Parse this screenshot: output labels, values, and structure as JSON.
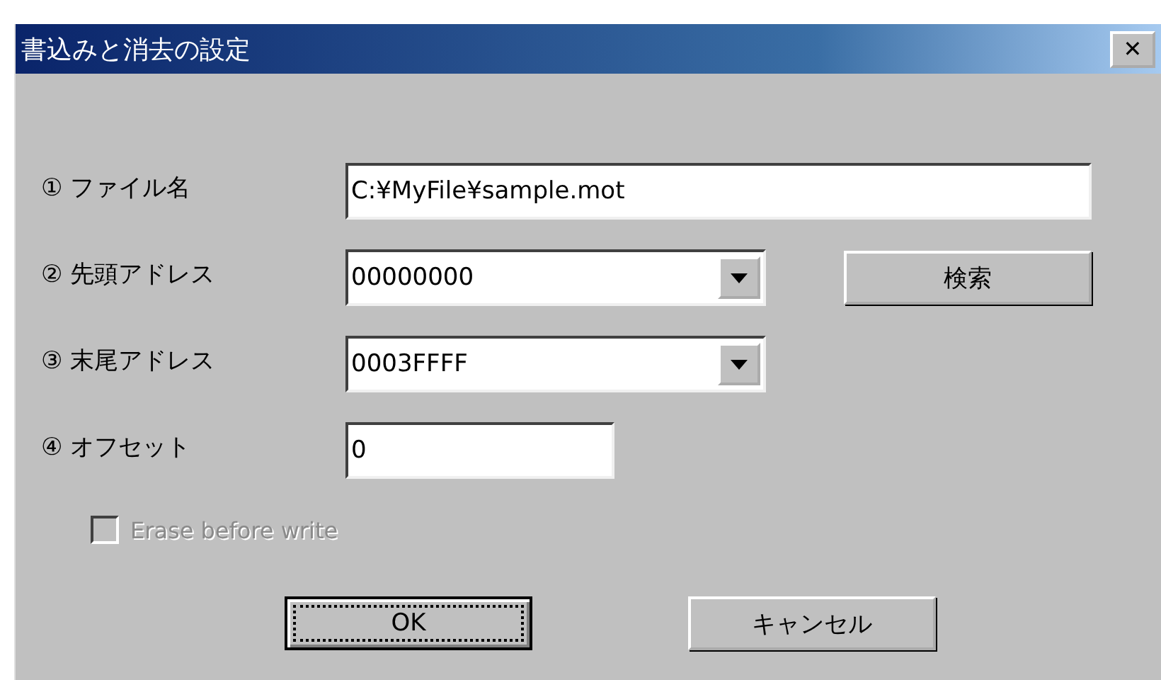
{
  "window": {
    "title": "書込みと消去の設定",
    "close": "✕"
  },
  "fields": [
    {
      "kind": "text",
      "label": "① ファイル名",
      "value": "C:¥MyFile¥sample.mot"
    },
    {
      "kind": "combo",
      "label": "② 先頭アドレス",
      "value": "00000000",
      "button": "検索"
    },
    {
      "kind": "combo",
      "label": "③ 末尾アドレス",
      "value": "0003FFFF"
    },
    {
      "kind": "short",
      "label": "④ オフセット",
      "value": "0"
    }
  ],
  "checkbox": {
    "label": "Erase before write",
    "checked": false,
    "disabled": true
  },
  "buttons": [
    {
      "label": "OK",
      "focused": true
    },
    {
      "label": "キャンセル",
      "focused": false
    }
  ]
}
